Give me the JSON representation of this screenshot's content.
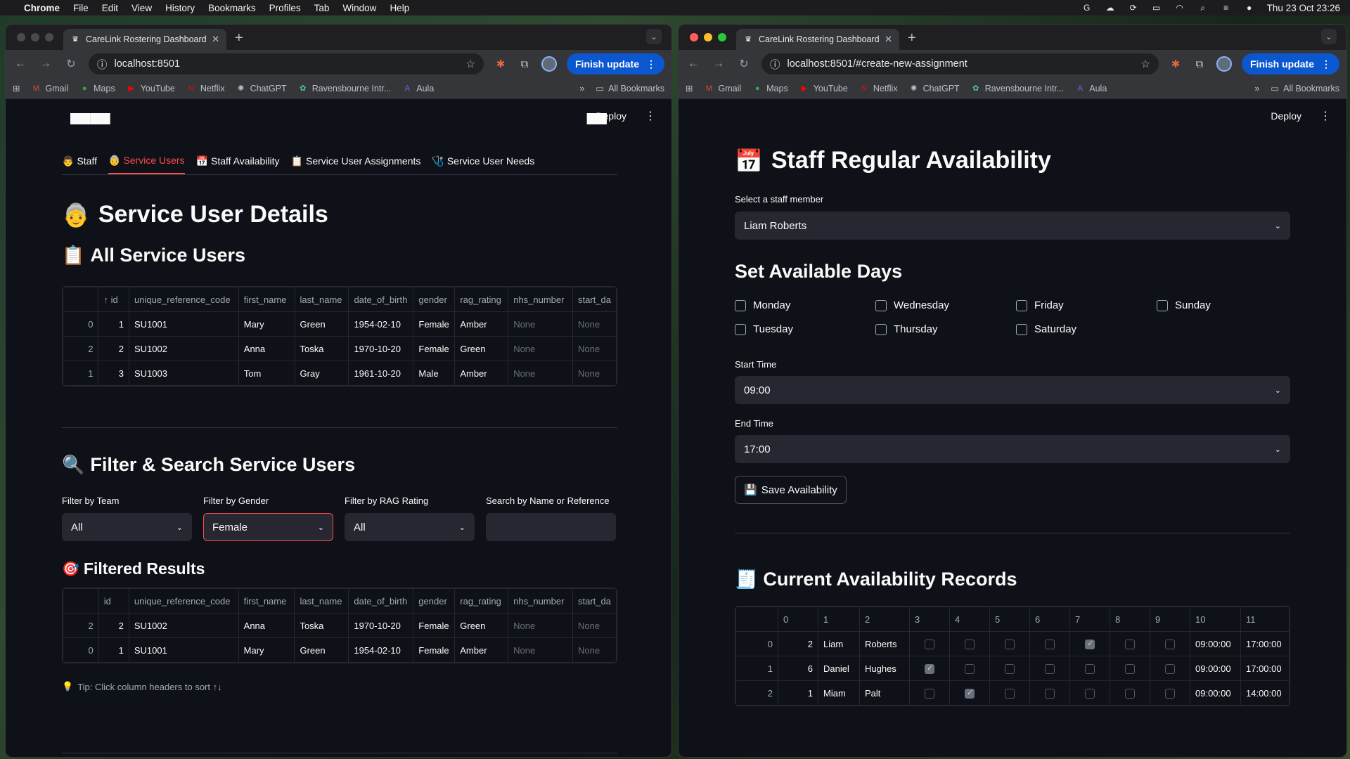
{
  "menubar": {
    "app": "Chrome",
    "items": [
      "File",
      "Edit",
      "View",
      "History",
      "Bookmarks",
      "Profiles",
      "Tab",
      "Window",
      "Help"
    ],
    "clock": "Thu 23 Oct  23:26"
  },
  "left_window": {
    "tab_title": "CareLink Rostering Dashboard",
    "url": "localhost:8501",
    "finish_update": "Finish update",
    "bookmarks": [
      "Gmail",
      "Maps",
      "YouTube",
      "Netflix",
      "ChatGPT",
      "Ravensbourne Intr...",
      "Aula"
    ],
    "all_bookmarks": "All Bookmarks",
    "deploy": "Deploy",
    "tabs": [
      {
        "icon": "👨",
        "label": "Staff"
      },
      {
        "icon": "👵",
        "label": "Service Users"
      },
      {
        "icon": "📅",
        "label": "Staff Availability"
      },
      {
        "icon": "📋",
        "label": "Service User Assignments"
      },
      {
        "icon": "🩺",
        "label": "Service User Needs"
      }
    ],
    "page_title": "Service User Details",
    "all_users_heading": "All Service Users",
    "columns": [
      "",
      "↑ id",
      "unique_reference_code",
      "first_name",
      "last_name",
      "date_of_birth",
      "gender",
      "rag_rating",
      "nhs_number",
      "start_da"
    ],
    "rows": [
      [
        "0",
        "1",
        "SU1001",
        "Mary",
        "Green",
        "1954-02-10",
        "Female",
        "Amber",
        "None",
        "None"
      ],
      [
        "2",
        "2",
        "SU1002",
        "Anna",
        "Toska",
        "1970-10-20",
        "Female",
        "Green",
        "None",
        "None"
      ],
      [
        "1",
        "3",
        "SU1003",
        "Tom",
        "Gray",
        "1961-10-20",
        "Male",
        "Amber",
        "None",
        "None"
      ]
    ],
    "filter_heading": "Filter & Search Service Users",
    "filters": {
      "team_label": "Filter by Team",
      "team_value": "All",
      "gender_label": "Filter by Gender",
      "gender_value": "Female",
      "rag_label": "Filter by RAG Rating",
      "rag_value": "All",
      "search_label": "Search by Name or Reference"
    },
    "filtered_heading": "Filtered Results",
    "filtered_columns": [
      "",
      "id",
      "unique_reference_code",
      "first_name",
      "last_name",
      "date_of_birth",
      "gender",
      "rag_rating",
      "nhs_number",
      "start_da"
    ],
    "filtered_rows": [
      [
        "2",
        "2",
        "SU1002",
        "Anna",
        "Toska",
        "1970-10-20",
        "Female",
        "Green",
        "None",
        "None"
      ],
      [
        "0",
        "1",
        "SU1001",
        "Mary",
        "Green",
        "1954-02-10",
        "Female",
        "Amber",
        "None",
        "None"
      ]
    ],
    "tip": "Tip: Click column headers to sort ↑↓"
  },
  "right_window": {
    "tab_title": "CareLink Rostering Dashboard",
    "url": "localhost:8501/#create-new-assignment",
    "finish_update": "Finish update",
    "bookmarks": [
      "Gmail",
      "Maps",
      "YouTube",
      "Netflix",
      "ChatGPT",
      "Ravensbourne Intr...",
      "Aula"
    ],
    "all_bookmarks": "All Bookmarks",
    "deploy": "Deploy",
    "page_title": "Staff Regular Availability",
    "staff_label": "Select a staff member",
    "staff_value": "Liam Roberts",
    "days_heading": "Set Available Days",
    "days": [
      "Monday",
      "Wednesday",
      "Friday",
      "Sunday",
      "Tuesday",
      "Thursday",
      "Saturday"
    ],
    "start_label": "Start Time",
    "start_value": "09:00",
    "end_label": "End Time",
    "end_value": "17:00",
    "save_button": "Save Availability",
    "records_heading": "Current Availability Records",
    "record_columns": [
      "",
      "0",
      "1",
      "2",
      "3",
      "4",
      "5",
      "6",
      "7",
      "8",
      "9",
      "10",
      "11"
    ],
    "records": [
      {
        "idx": "0",
        "c0": "2",
        "c1": "Liam",
        "c2": "Roberts",
        "checks": [
          false,
          false,
          false,
          false,
          true,
          false,
          false
        ],
        "c10": "09:00:00",
        "c11": "17:00:00"
      },
      {
        "idx": "1",
        "c0": "6",
        "c1": "Daniel",
        "c2": "Hughes",
        "checks": [
          true,
          false,
          false,
          false,
          false,
          false,
          false
        ],
        "c10": "09:00:00",
        "c11": "17:00:00"
      },
      {
        "idx": "2",
        "c0": "1",
        "c1": "Miam",
        "c2": "Palt",
        "checks": [
          false,
          true,
          false,
          false,
          false,
          false,
          false
        ],
        "c10": "09:00:00",
        "c11": "14:00:00"
      }
    ]
  }
}
